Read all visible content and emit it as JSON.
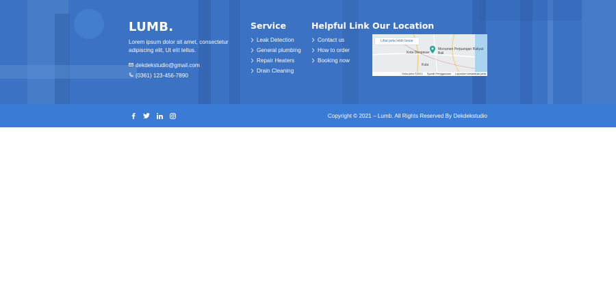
{
  "brand": {
    "name": "LUMB."
  },
  "about": {
    "text": "Lorem ipsum dolor sit amet, consectetur adipiscing elit, Ut elit tellus."
  },
  "contact": {
    "email": "dekdekstudio@gmail.com",
    "phone": "(0361) 123-456-7890"
  },
  "service": {
    "title": "Service",
    "items": [
      "Leak Detection",
      "General plumbing",
      "Repair Heaters",
      "Drain Cleaning"
    ]
  },
  "helpful": {
    "title": "Helpful Link",
    "items": [
      "Contact us",
      "How to order",
      "Booking now"
    ]
  },
  "location": {
    "title": "Our Location",
    "map": {
      "larger_map": "Lihat peta lebih besar",
      "place_name": "Monumen Perjuangan Rakyat Bali",
      "city_label": "Kota Denpasar",
      "district_label": "Kuta",
      "footer_data": "Data peta ©2021",
      "footer_terms": "Syarat Penggunaan",
      "footer_report": "Laporkan kesalahan peta"
    }
  },
  "socials": [
    "facebook-icon",
    "twitter-icon",
    "linkedin-icon",
    "instagram-icon"
  ],
  "copyright": "Copyright © 2021 – Lumb. All Rights Reserved By Dekdekstudio",
  "colors": {
    "footer_bg": "#3f76c6",
    "bottom_bar": "#3a7bd5",
    "text": "#ffffff"
  }
}
